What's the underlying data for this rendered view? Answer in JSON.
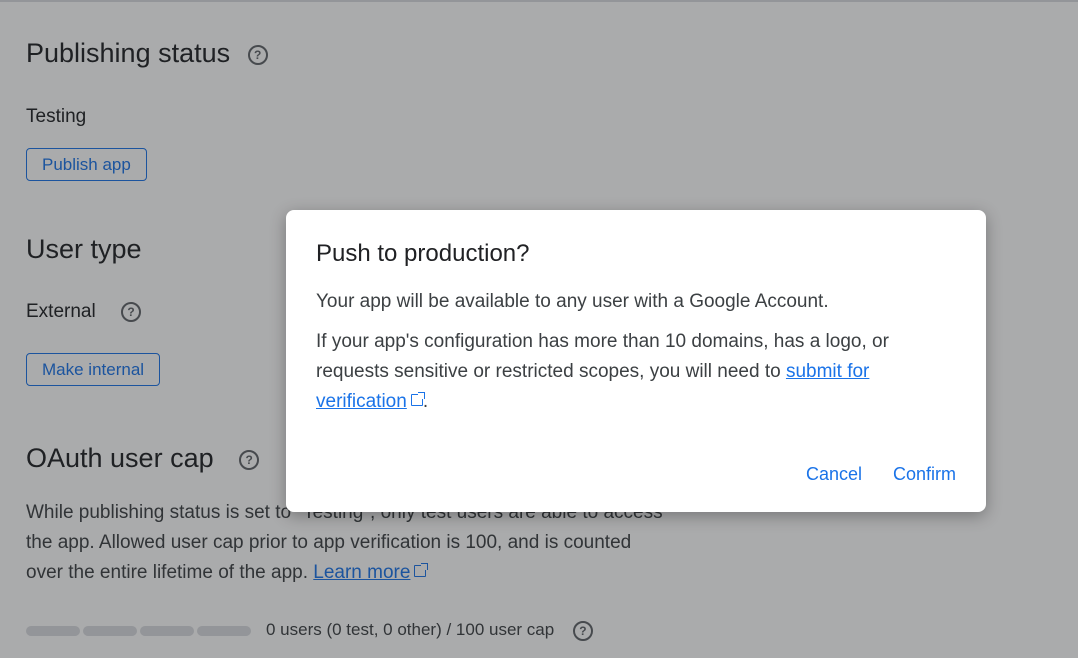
{
  "publishing": {
    "title": "Publishing status",
    "status_label": "Testing",
    "publish_button": "Publish app"
  },
  "user_type": {
    "title": "User type",
    "value": "External",
    "make_internal_button": "Make internal"
  },
  "oauth_cap": {
    "title": "OAuth user cap",
    "description": "While publishing status is set to \"Testing\", only test users are able to access the app. Allowed user cap prior to app verification is 100, and is counted over the entire lifetime of the app.",
    "learn_more": "Learn more",
    "cap_text": "0 users (0 test, 0 other) / 100 user cap",
    "cap_fraction": 0
  },
  "icons": {
    "help": "help-circle-icon",
    "external": "open-in-new-icon"
  },
  "dialog": {
    "title": "Push to production?",
    "para1": "Your app will be available to any user with a Google Account.",
    "para2_prefix": "If your app's configuration has more than 10 domains, has a logo, or requests sensitive or restricted scopes, you will need to",
    "para2_link": "submit for verification",
    "para2_suffix": ".",
    "cancel": "Cancel",
    "confirm": "Confirm"
  },
  "colors": {
    "accent": "#1a73e8",
    "scrim": "#202124"
  }
}
